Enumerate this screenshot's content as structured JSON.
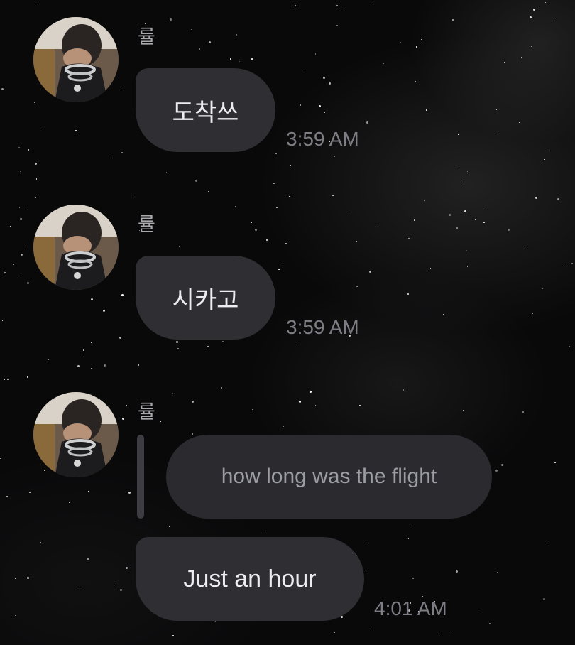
{
  "messages": [
    {
      "sender": "률",
      "text": "도착쓰",
      "time": "3:59 AM",
      "avatar": "avatar-photo-icon"
    },
    {
      "sender": "률",
      "text": "시카고",
      "time": "3:59 AM",
      "avatar": "avatar-photo-icon"
    },
    {
      "sender": "률",
      "quoted_reply": "how long was the flight",
      "text": "Just an hour",
      "time": "4:01 AM",
      "avatar": "avatar-photo-icon"
    }
  ],
  "colors": {
    "background": "#09090a",
    "bubble": "#2e2e33",
    "quoted_bubble": "#2a2a2f",
    "text": "#ededf0",
    "timestamp": "#7d7d84",
    "sender_name": "#a9a9ad"
  }
}
